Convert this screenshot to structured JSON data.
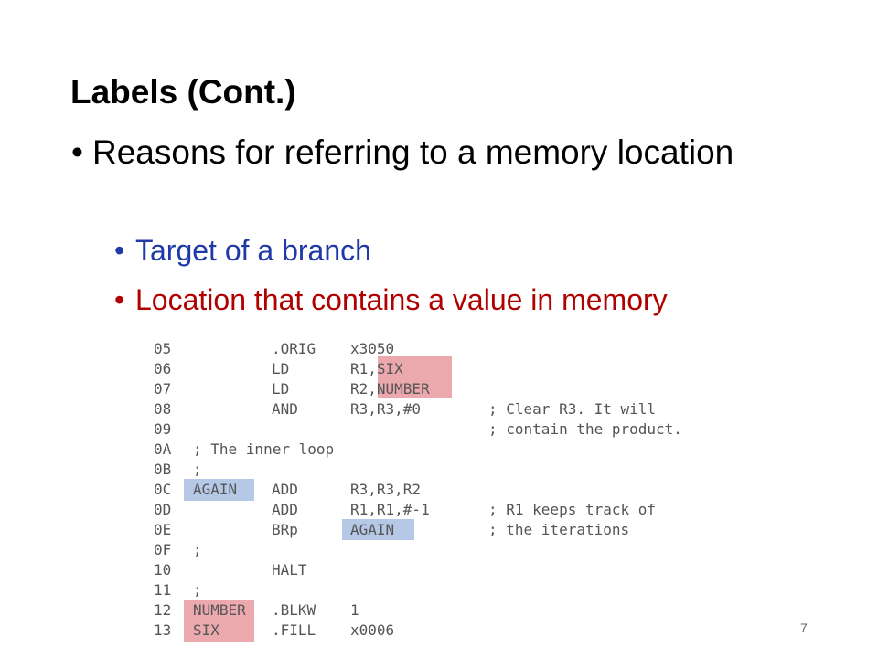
{
  "slide": {
    "title": "Labels (Cont.)",
    "bullet_main": "Reasons for referring to a memory location",
    "bullet_dot": "•",
    "sub_bullets": [
      {
        "text": "Target of a branch",
        "color": "#1f3aa8"
      },
      {
        "text": "Location that contains a value in memory",
        "color": "#b00000"
      }
    ],
    "page_number": "7"
  },
  "code": {
    "lines": [
      {
        "no": "05",
        "label": "",
        "op": ".ORIG",
        "args": "x3050",
        "comment": ""
      },
      {
        "no": "06",
        "label": "",
        "op": "LD",
        "args": "R1,SIX",
        "comment": ""
      },
      {
        "no": "07",
        "label": "",
        "op": "LD",
        "args": "R2,NUMBER",
        "comment": ""
      },
      {
        "no": "08",
        "label": "",
        "op": "AND",
        "args": "R3,R3,#0",
        "comment": "; Clear R3. It will"
      },
      {
        "no": "09",
        "label": "",
        "op": "",
        "args": "",
        "comment": "; contain the product."
      },
      {
        "no": "0A",
        "label": "; The inner loop",
        "op": "",
        "args": "",
        "comment": ""
      },
      {
        "no": "0B",
        "label": ";",
        "op": "",
        "args": "",
        "comment": ""
      },
      {
        "no": "0C",
        "label": "AGAIN",
        "op": "ADD",
        "args": "R3,R3,R2",
        "comment": ""
      },
      {
        "no": "0D",
        "label": "",
        "op": "ADD",
        "args": "R1,R1,#-1",
        "comment": "; R1 keeps track of"
      },
      {
        "no": "0E",
        "label": "",
        "op": "BRp",
        "args": "AGAIN",
        "comment": "; the iterations"
      },
      {
        "no": "0F",
        "label": ";",
        "op": "",
        "args": "",
        "comment": ""
      },
      {
        "no": "10",
        "label": "",
        "op": "HALT",
        "args": "",
        "comment": ""
      },
      {
        "no": "11",
        "label": ";",
        "op": "",
        "args": "",
        "comment": ""
      },
      {
        "no": "12",
        "label": "NUMBER",
        "op": ".BLKW",
        "args": "1",
        "comment": ""
      },
      {
        "no": "13",
        "label": "SIX",
        "op": ".FILL",
        "args": "x0006",
        "comment": ""
      }
    ],
    "highlight_colors": {
      "red": "#eba9ae",
      "blue": "#b5c9e6"
    }
  }
}
